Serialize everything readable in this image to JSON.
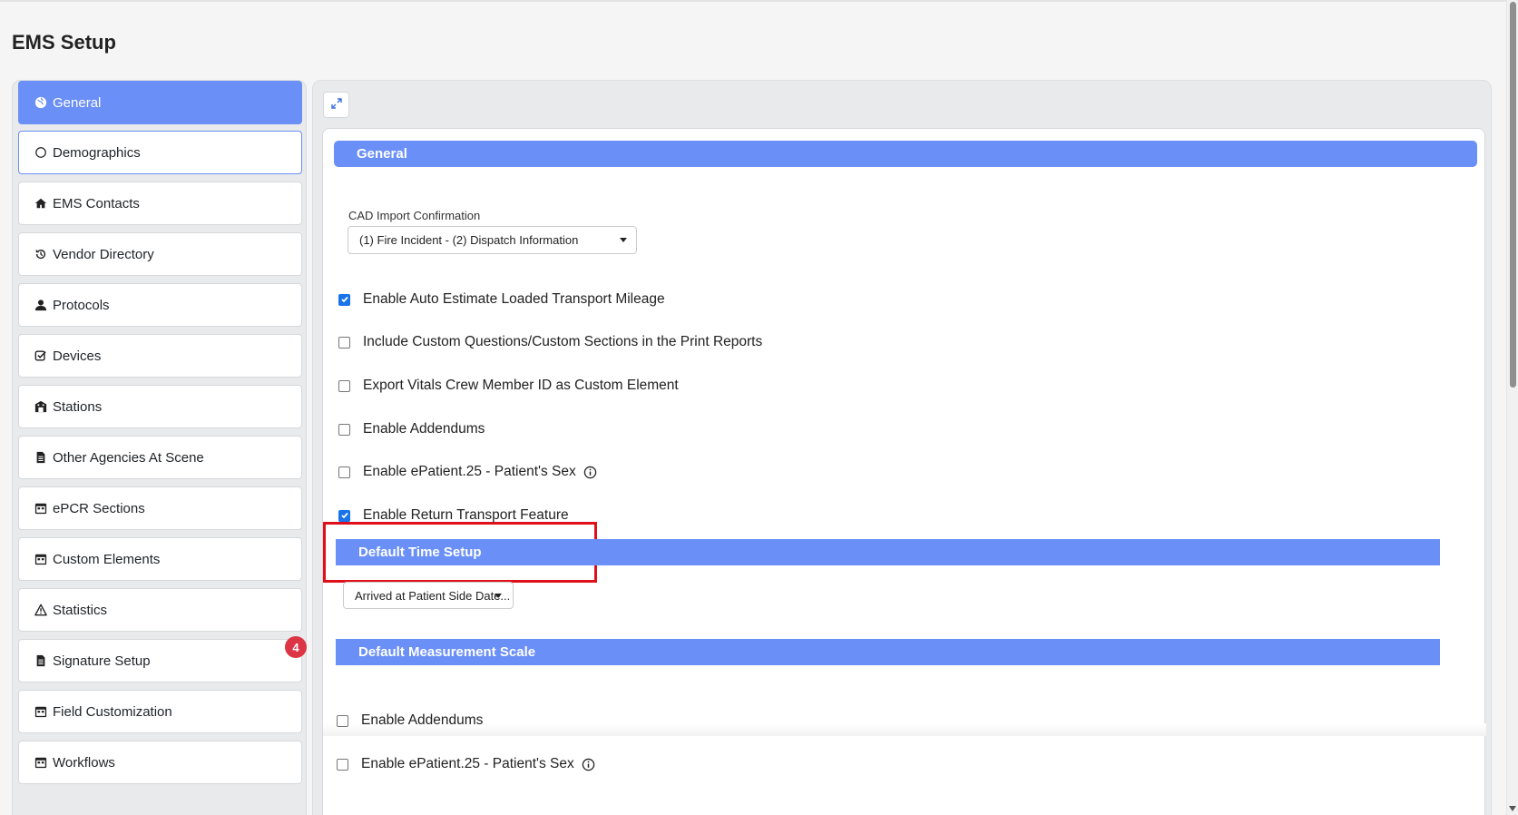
{
  "page": {
    "title": "EMS Setup"
  },
  "sidebar": {
    "items": [
      {
        "label": "General",
        "icon": "globe-icon",
        "state": "active"
      },
      {
        "label": "Demographics",
        "icon": "circle-icon",
        "state": "outlined"
      },
      {
        "label": "EMS Contacts",
        "icon": "home-icon"
      },
      {
        "label": "Vendor Directory",
        "icon": "history-icon"
      },
      {
        "label": "Protocols",
        "icon": "user-icon"
      },
      {
        "label": "Devices",
        "icon": "check-square-icon"
      },
      {
        "label": "Stations",
        "icon": "building-icon"
      },
      {
        "label": "Other Agencies At Scene",
        "icon": "file-icon"
      },
      {
        "label": "ePCR Sections",
        "icon": "calendar-icon"
      },
      {
        "label": "Custom Elements",
        "icon": "calendar-icon"
      },
      {
        "label": "Statistics",
        "icon": "warning-icon"
      },
      {
        "label": "Signature Setup",
        "icon": "file-icon",
        "badge": "4"
      },
      {
        "label": "Field Customization",
        "icon": "calendar-icon"
      },
      {
        "label": "Workflows",
        "icon": "calendar-icon"
      }
    ]
  },
  "main": {
    "expand_icon": "expand-icon",
    "general_header": "General",
    "cad_label": "CAD Import Confirmation",
    "cad_value": "(1) Fire Incident - (2) Dispatch Information",
    "checkboxes": [
      {
        "label": "Enable Auto Estimate Loaded Transport Mileage",
        "checked": true
      },
      {
        "label": "Include Custom Questions/Custom Sections in the Print Reports",
        "checked": false
      },
      {
        "label": "Export Vitals Crew Member ID as Custom Element",
        "checked": false
      },
      {
        "label": "Enable Addendums",
        "checked": false
      },
      {
        "label": "Enable ePatient.25 - Patient's Sex",
        "checked": false,
        "info": true
      },
      {
        "label": "Enable Return Transport Feature",
        "checked": true
      }
    ],
    "time_header": "Default Time Setup",
    "time_value": "Arrived at Patient Side Date...",
    "measure_header": "Default Measurement Scale",
    "lower_checkboxes": [
      {
        "label": "Enable Addendums",
        "checked": false
      },
      {
        "label": "Enable ePatient.25 - Patient's Sex",
        "checked": false,
        "info": true
      }
    ]
  },
  "colors": {
    "accent": "#6a8ff7",
    "highlight": "#e0101a",
    "badge": "#dc3545"
  }
}
